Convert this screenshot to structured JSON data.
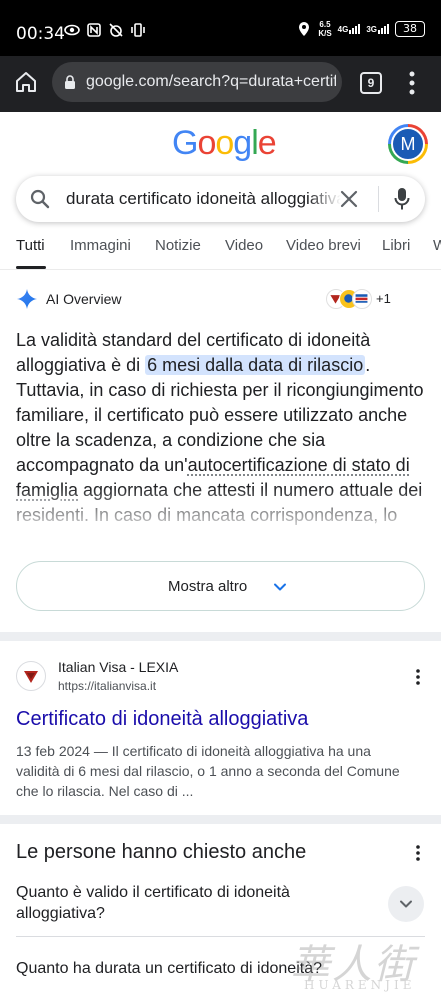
{
  "status_bar": {
    "time": "00:34",
    "net_speed": "6.5",
    "net_unit": "K/S",
    "net1": "4G",
    "net2": "3G",
    "battery": "38"
  },
  "browser": {
    "url": "google.com/search?q=durata+certificato",
    "tab_count": "9"
  },
  "header": {
    "logo_letters": [
      "G",
      "o",
      "o",
      "g",
      "l",
      "e"
    ],
    "logo_colors": [
      "#4285f4",
      "#ea4335",
      "#fbbc05",
      "#4285f4",
      "#34a853",
      "#ea4335"
    ],
    "avatar_letter": "M"
  },
  "search": {
    "query": "durata certificato idoneità alloggiativa"
  },
  "tabs": [
    "Tutti",
    "Immagini",
    "Notizie",
    "Video",
    "Video brevi",
    "Libri",
    "W"
  ],
  "ai_overview": {
    "title": "AI Overview",
    "sources_more": "+1",
    "text_before": "La validità standard del certificato di idoneità alloggiativa è di ",
    "text_highlight": "6 mesi dalla data di rilascio",
    "text_middle": ". Tuttavia, in caso di richiesta per il ricongiungimento familiare, il certificato può essere utilizzato anche oltre la scadenza, a condizione che sia accompagnato da un'",
    "text_link": "autocertificazione di stato di famiglia",
    "text_after": " aggiornata che attesti il numero attuale dei residenti. In caso di mancata corrispondenza, lo",
    "more_label": "Mostra altro"
  },
  "result": {
    "site_name": "Italian Visa - LEXIA",
    "url": "https://italianvisa.it",
    "title": "Certificato di idoneità alloggiativa",
    "snippet": "13 feb 2024 — Il certificato di idoneità alloggiativa ha una validità di 6 mesi dal rilascio, o 1 anno a seconda del Comune che lo rilascia. Nel caso di ..."
  },
  "people_also_ask": {
    "title": "Le persone hanno chiesto anche",
    "questions": [
      "Quanto è valido il certificato di idoneità alloggiativa?",
      "Quanto ha durata un certificato di idoneità?"
    ]
  },
  "watermark": {
    "cn": "華人街",
    "en": "HUARENJIE"
  },
  "colors": {
    "accent_blue": "#1a0dab",
    "highlight": "#d3e3fd",
    "status_bg": "#000000",
    "toolbar_bg": "#202124"
  }
}
